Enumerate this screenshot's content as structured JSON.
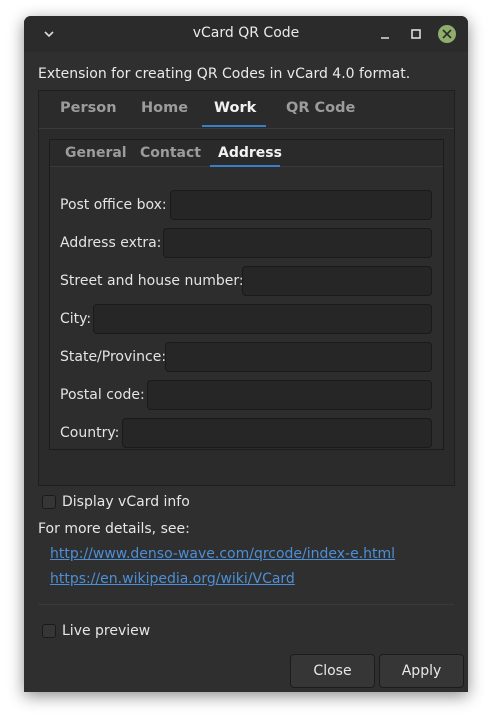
{
  "window": {
    "title": "vCard QR Code"
  },
  "description": "Extension for creating QR Codes in vCard 4.0 format.",
  "tabs": [
    "Person",
    "Home",
    "Work",
    "QR Code"
  ],
  "subtabs": [
    "General",
    "Contact",
    "Address"
  ],
  "fields": [
    {
      "label": "Post office box:",
      "value": ""
    },
    {
      "label": "Address extra:",
      "value": ""
    },
    {
      "label": "Street and house number:",
      "value": ""
    },
    {
      "label": "City:",
      "value": ""
    },
    {
      "label": "State/Province:",
      "value": ""
    },
    {
      "label": "Postal code:",
      "value": ""
    },
    {
      "label": "Country:",
      "value": ""
    }
  ],
  "display_vcard_info": "Display vCard info",
  "more_details": "For more details, see:",
  "links": [
    "http://www.denso-wave.com/qrcode/index-e.html",
    "https://en.wikipedia.org/wiki/VCard"
  ],
  "live_preview": "Live preview",
  "buttons": {
    "close": "Close",
    "apply": "Apply"
  }
}
